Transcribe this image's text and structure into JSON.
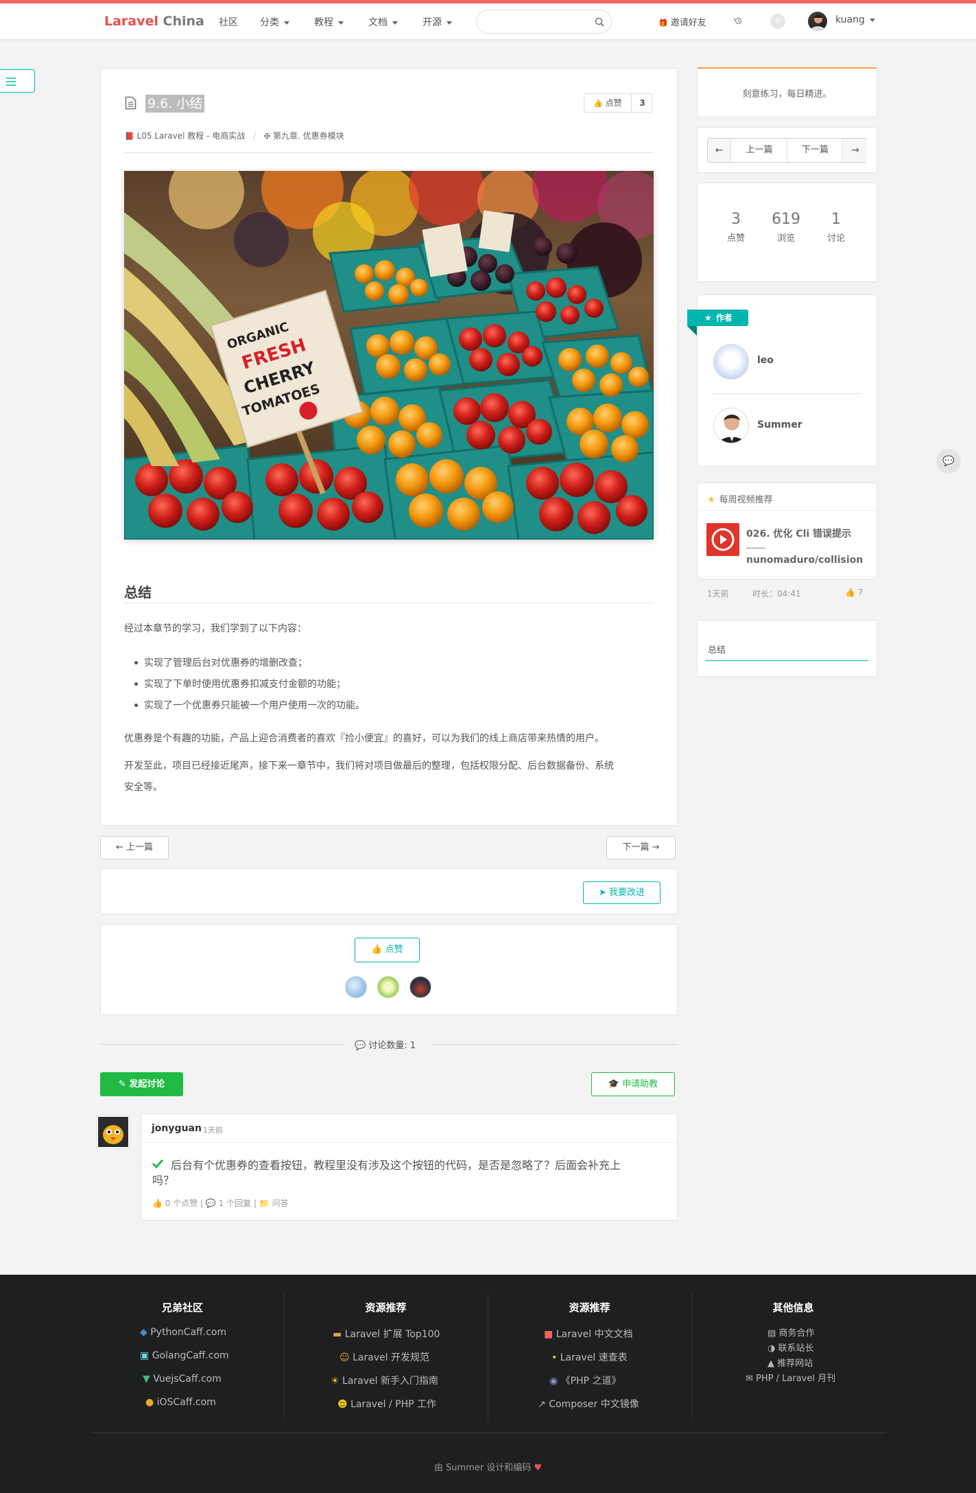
{
  "nav": {
    "brand_red": "Laravel",
    "brand_gray": "China",
    "items": [
      "社区",
      "分类",
      "教程",
      "文档",
      "开源"
    ],
    "search_placeholder": "",
    "invite": "邀请好友",
    "notif_count": "0",
    "username": "kuang"
  },
  "article": {
    "title": "9.6. 小结",
    "like_label": "点赞",
    "like_count": "3",
    "breadcrumb_book": "L05 Laravel 教程 - 电商实战",
    "breadcrumb_chapter": "第九章. 优惠券模块",
    "section_heading": "总结",
    "intro": "经过本章节的学习，我们学到了以下内容：",
    "bullets": [
      "实现了管理后台对优惠券的增删改查；",
      "实现了下单时使用优惠券扣减支付金额的功能；",
      "实现了一个优惠券只能被一个用户使用一次的功能。"
    ],
    "para1": "优惠券是个有趣的功能，产品上迎合消费者的喜欢『捡小便宜』的喜好，可以为我们的线上商店带来热情的用户。",
    "para2_line1": "开发至此，项目已经接近尾声，接下来一章节中，我们将对项目做最后的整理，包括权限分配、后台数据备份、系统",
    "para2_line2": "安全等。",
    "image_sign": [
      "ORGANIC",
      "FRESH",
      "CHERRY",
      "TOMATOES"
    ]
  },
  "pager": {
    "prev": "上一篇",
    "next": "下一篇"
  },
  "improve_label": "我要改进",
  "like_section": {
    "button": "点赞"
  },
  "discussion": {
    "count_label": "讨论数量:",
    "count": "1",
    "new_button": "发起讨论",
    "help_button": "申请助教",
    "comment": {
      "author": "jonyguan",
      "time": "1天前",
      "text_line1": "后台有个优惠券的查看按钮，教程里没有涉及这个按钮的代码，是否是忽略了？后面会补充上",
      "text_line2": "吗？",
      "likes": "0 个点赞",
      "replies": "1 个回复",
      "tag": "问答"
    }
  },
  "sidebar": {
    "motto": "刻意练习，每日精进。",
    "prev": "上一篇",
    "next": "下一篇",
    "stats": [
      {
        "value": "3",
        "label": "点赞"
      },
      {
        "value": "619",
        "label": "浏览"
      },
      {
        "value": "1",
        "label": "讨论"
      }
    ],
    "author_ribbon": "作者",
    "authors": [
      "leo",
      "Summer"
    ],
    "video_header": "每周视频推荐",
    "video_title1": "026. 优化 Cli 错误提示",
    "video_title2": "nunomaduro/collision",
    "video_time": "1天前",
    "video_duration": "时长：04:41",
    "video_likes": "7",
    "toc_item": "总结"
  },
  "footer": {
    "cols": [
      {
        "title": "兄弟社区",
        "links": [
          "PythonCaff.com",
          "GolangCaff.com",
          "VuejsCaff.com",
          "iOSCaff.com"
        ]
      },
      {
        "title": "资源推荐",
        "links": [
          "Laravel 扩展 Top100",
          "Laravel 开发规范",
          "Laravel 新手入门指南",
          "Laravel / PHP 工作"
        ]
      },
      {
        "title": "资源推荐",
        "links": [
          "Laravel 中文文档",
          "Laravel 速查表",
          "《PHP 之道》",
          "Composer 中文镜像"
        ]
      },
      {
        "title": "其他信息",
        "links": [
          "商务合作",
          "联系站长",
          "推荐网站",
          "PHP / Laravel 月刊"
        ]
      }
    ],
    "credit": "由 Summer 设计和编码"
  },
  "colors": {
    "brand": "#e8504a",
    "accent": "#00b5ad",
    "green": "#21ba45",
    "footer_bg": "#1e1f21"
  }
}
